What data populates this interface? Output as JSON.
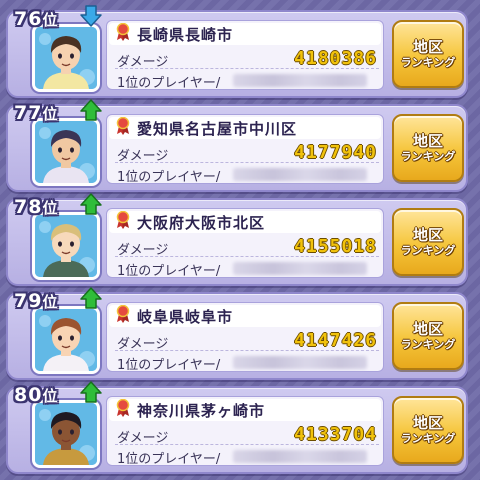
{
  "colors": {
    "background": "#6f6aa8",
    "panel": "#c4bee9",
    "damage_gold": "#f1c20b",
    "button_gold": "#f5c53a",
    "arrow_up": "#2fbd39",
    "arrow_down": "#3aa9e8"
  },
  "labels": {
    "rank_suffix": "位",
    "damage": "ダメージ",
    "top_player": "1位のプレイヤー/",
    "button_line1": "地区",
    "button_line2": "ランキング"
  },
  "rows": [
    {
      "rank": "76",
      "trend": "down",
      "trend_icon": "arrow-down-icon",
      "region": "長崎県長崎市",
      "damage": "4180386",
      "avatar": {
        "hair": "#4a3223",
        "skin": "#f6d2b0",
        "shirt": "#f3e7a2"
      }
    },
    {
      "rank": "77",
      "trend": "up",
      "trend_icon": "arrow-up-icon",
      "region": "愛知県名古屋市中川区",
      "damage": "4177940",
      "avatar": {
        "hair": "#3a3556",
        "skin": "#f0c8a2",
        "shirt": "#e9e4f2"
      }
    },
    {
      "rank": "78",
      "trend": "up",
      "trend_icon": "arrow-up-icon",
      "region": "大阪府大阪市北区",
      "damage": "4155018",
      "avatar": {
        "hair": "#d9bf7a",
        "skin": "#f7d9bb",
        "shirt": "#4b6b58"
      }
    },
    {
      "rank": "79",
      "trend": "up",
      "trend_icon": "arrow-up-icon",
      "region": "岐阜県岐阜市",
      "damage": "4147426",
      "avatar": {
        "hair": "#9b5430",
        "skin": "#f8d4b4",
        "shirt": "#f4f1f6"
      }
    },
    {
      "rank": "80",
      "trend": "up",
      "trend_icon": "arrow-up-icon",
      "region": "神奈川県茅ヶ崎市",
      "damage": "4133704",
      "avatar": {
        "hair": "#1f1a22",
        "skin": "#8b5534",
        "shirt": "#c79a3e"
      }
    }
  ]
}
